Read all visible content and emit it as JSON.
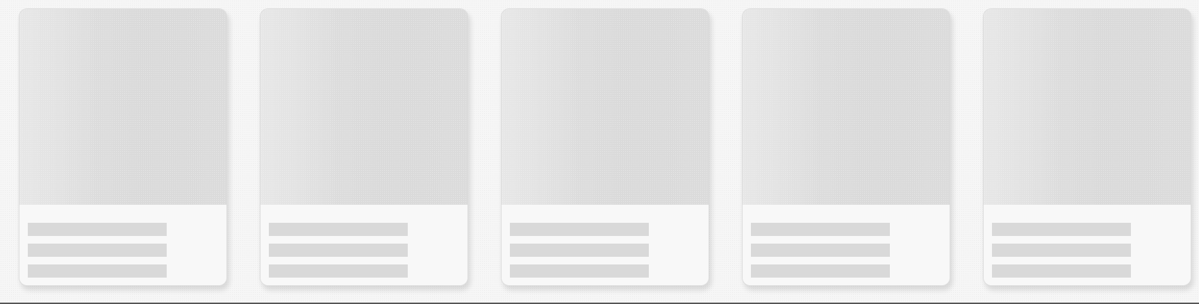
{
  "view": {
    "state": "loading-skeleton"
  },
  "cards": [
    {
      "placeholder_lines": 3
    },
    {
      "placeholder_lines": 3
    },
    {
      "placeholder_lines": 3
    },
    {
      "placeholder_lines": 3
    },
    {
      "placeholder_lines": 3
    }
  ],
  "colors": {
    "background": "#f6f6f6",
    "card_background": "#f7f7f7",
    "skeleton_fill": "#d9d9d9",
    "card_border": "#dcdcdc"
  }
}
